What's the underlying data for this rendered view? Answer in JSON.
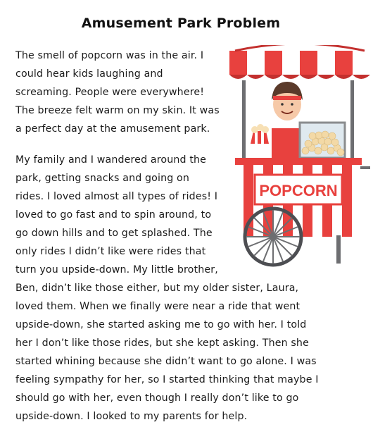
{
  "title": "Amusement Park Problem",
  "paragraph1": [
    "The smell of popcorn was in the air. I",
    "could hear kids laughing and",
    "screaming. People were everywhere!",
    "The breeze felt warm on my skin. It was",
    "a perfect day at the amusement park."
  ],
  "paragraph2": [
    "My family and I wandered around the",
    "park, getting snacks and going on",
    "rides. I loved almost all types of rides! I",
    "loved to go fast and to spin around, to",
    "go down hills and to get splashed. The",
    "only rides I didn’t like were rides that",
    "turn you upside-down. My little brother,",
    "Ben, didn’t like those either, but my older sister, Laura,",
    "loved them. When we finally were near a ride that went",
    "upside-down, she started asking me to go with her. I told",
    "her I don’t like those rides, but she kept asking. Then she",
    "started whining because she didn’t want to go alone. I was",
    "feeling sympathy for her, so I started thinking that maybe I",
    "should go with her, even though I really don’t like to go",
    "upside-down. I looked to my parents for help."
  ],
  "illustration": {
    "cart_sign": "POPCORN",
    "colors": {
      "red": "#e8413e",
      "dark_red": "#c3302e",
      "white": "#ffffff",
      "grey": "#6d6e71"
    }
  }
}
